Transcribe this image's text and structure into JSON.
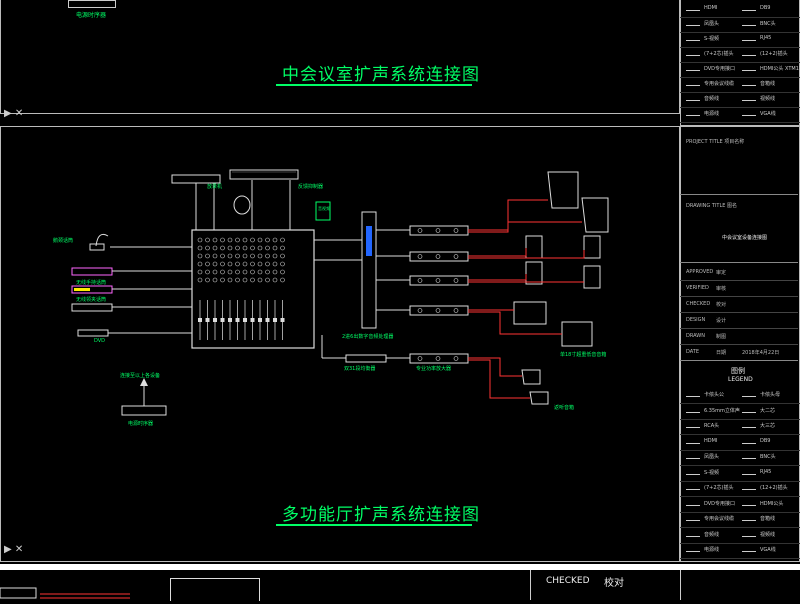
{
  "top_section": {
    "device_label": "电源时序器",
    "title": "中会议室扩声系统连接图"
  },
  "main_section": {
    "title": "多功能厅扩声系统连接图",
    "equipment": {
      "player": "放录机",
      "feedback": "反馈抑制器",
      "wired_mic": "鹅颈话筒",
      "wireless_hand": "无线手持话筒",
      "wireless_lapel": "无线领夹话筒",
      "dvd": "DVD",
      "processor": "2进6出数字音频处理器",
      "crossover": "双31段均衡器",
      "amplifier": "专业功率放大器",
      "link_label": "连接至以上各设备",
      "sequencer": "电源时序器",
      "sub_speaker": "单18寸超重低音音箱",
      "monitor_speaker": "返听音箱",
      "side_green": "音视频"
    }
  },
  "title_block": {
    "project_title": "PROJECT TITLE 项目名称",
    "drawing_title": "DRAWING TITLE 图名",
    "drawing_name": "中会议室设备连接图",
    "rows": [
      {
        "en": "APPROVED",
        "zh": "审定"
      },
      {
        "en": "VERIFIED",
        "zh": "审核"
      },
      {
        "en": "CHECKED",
        "zh": "校对"
      },
      {
        "en": "DESIGN",
        "zh": "设计"
      },
      {
        "en": "DRAWN",
        "zh": "制图"
      },
      {
        "en": "DATE",
        "zh": "日期",
        "value": "2018年4月22日"
      }
    ],
    "legend_title": "图例",
    "legend_en": "LEGEND"
  },
  "legend_items": [
    {
      "left": "卡侬头公",
      "right": "卡侬头母"
    },
    {
      "left": "6.35mm立体声",
      "right": "大二芯"
    },
    {
      "left": "RCA头",
      "right": "大三芯"
    },
    {
      "left": "HDMI",
      "right": "DB9"
    },
    {
      "left": "凤凰头",
      "right": "BNC头"
    },
    {
      "left": "S-视频",
      "right": "RJ45"
    },
    {
      "left": "(7+2芯)插头",
      "right": "(12+2)插头"
    },
    {
      "left": "DVD专用接口",
      "right": "HDMI公头"
    },
    {
      "left": "专用会议线缆",
      "right": "音箱线"
    },
    {
      "left": "音频线",
      "right": "视频线"
    },
    {
      "left": "电源线",
      "right": "VGA线"
    }
  ],
  "top_legend_items": [
    {
      "left": "HDMI",
      "right": "DB9"
    },
    {
      "left": "凤凰头",
      "right": "BNC头"
    },
    {
      "left": "S-视频",
      "right": "RJ45"
    },
    {
      "left": "(7+2芯)插头",
      "right": "(12+2)插头"
    },
    {
      "left": "DVD专用接口",
      "right": "HDMI公头 XTM17线头"
    },
    {
      "left": "专用会议线缆",
      "right": "音箱线"
    },
    {
      "left": "音频线",
      "right": "视频线"
    },
    {
      "left": "电源线",
      "right": "VGA线"
    }
  ],
  "bottom_strip": {
    "checked_en": "CHECKED",
    "checked_zh": "校对"
  },
  "colors": {
    "accent_green": "#00ff66",
    "line_white": "#dddddd",
    "line_red": "#ff3333",
    "background": "#000000"
  }
}
